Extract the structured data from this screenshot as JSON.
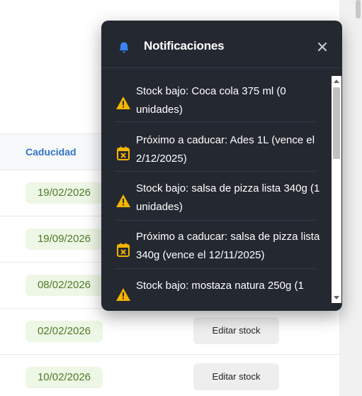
{
  "table": {
    "column_header": "Caducidad",
    "rows": [
      {
        "date": "19/02/2026"
      },
      {
        "date": "19/09/2026"
      },
      {
        "date": "08/02/2026"
      },
      {
        "date": "02/02/2026",
        "action": "Editar stock"
      },
      {
        "date": "10/02/2026",
        "action": "Editar stock"
      }
    ]
  },
  "notifications": {
    "title": "Notificaciones",
    "icons": {
      "bell": "bell-icon",
      "close": "close-icon",
      "low_stock": "warning-triangle-icon",
      "expiring": "calendar-x-icon"
    },
    "colors": {
      "bell": "#3b82f6",
      "warning": "#f5b400",
      "panel": "#242831"
    },
    "items": [
      {
        "type": "low_stock",
        "text": "Stock bajo: Coca cola 375 ml (0 unidades)"
      },
      {
        "type": "expiring",
        "text": "Próximo a caducar: Ades 1L (vence el 2/12/2025)"
      },
      {
        "type": "low_stock",
        "text": "Stock bajo: salsa de pizza lista 340g (1 unidades)"
      },
      {
        "type": "expiring",
        "text": "Próximo a caducar: salsa de pizza lista 340g (vence el 12/11/2025)"
      },
      {
        "type": "low_stock",
        "text": "Stock bajo: mostaza natura 250g (1"
      }
    ]
  }
}
